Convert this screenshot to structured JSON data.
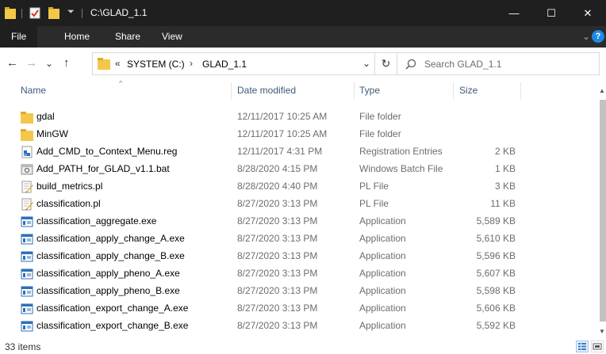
{
  "window": {
    "title": "C:\\GLAD_1.1"
  },
  "title_controls": {
    "minimize": "—",
    "maximize": "☐",
    "close": "✕"
  },
  "ribbon": {
    "tabs": [
      "File",
      "Home",
      "Share",
      "View"
    ],
    "expand": "⌄",
    "help": "?"
  },
  "nav": {
    "back": "←",
    "forward": "→",
    "recent": "⌄",
    "up": "↑",
    "overflow": "«",
    "breadcrumb": [
      "SYSTEM (C:)",
      "GLAD_1.1"
    ],
    "separator": "›",
    "dropdown": "⌄",
    "refresh": "↻",
    "search_placeholder": "Search GLAD_1.1"
  },
  "columns": {
    "name": "Name",
    "date": "Date modified",
    "type": "Type",
    "size": "Size",
    "sort_indicator": "^"
  },
  "files": [
    {
      "name": "gdal",
      "date": "12/11/2017 10:25 AM",
      "type": "File folder",
      "size": "",
      "icon": "folder-icon"
    },
    {
      "name": "MinGW",
      "date": "12/11/2017 10:25 AM",
      "type": "File folder",
      "size": "",
      "icon": "folder-icon"
    },
    {
      "name": "Add_CMD_to_Context_Menu.reg",
      "date": "12/11/2017 4:31 PM",
      "type": "Registration Entries",
      "size": "2 KB",
      "icon": "registry-file-icon"
    },
    {
      "name": "Add_PATH_for_GLAD_v1.1.bat",
      "date": "8/28/2020 4:15 PM",
      "type": "Windows Batch File",
      "size": "1 KB",
      "icon": "batch-file-icon"
    },
    {
      "name": "build_metrics.pl",
      "date": "8/28/2020 4:40 PM",
      "type": "PL File",
      "size": "3 KB",
      "icon": "script-file-icon"
    },
    {
      "name": "classification.pl",
      "date": "8/27/2020 3:13 PM",
      "type": "PL File",
      "size": "11 KB",
      "icon": "script-file-icon"
    },
    {
      "name": "classification_aggregate.exe",
      "date": "8/27/2020 3:13 PM",
      "type": "Application",
      "size": "5,589 KB",
      "icon": "application-icon"
    },
    {
      "name": "classification_apply_change_A.exe",
      "date": "8/27/2020 3:13 PM",
      "type": "Application",
      "size": "5,610 KB",
      "icon": "application-icon"
    },
    {
      "name": "classification_apply_change_B.exe",
      "date": "8/27/2020 3:13 PM",
      "type": "Application",
      "size": "5,596 KB",
      "icon": "application-icon"
    },
    {
      "name": "classification_apply_pheno_A.exe",
      "date": "8/27/2020 3:13 PM",
      "type": "Application",
      "size": "5,607 KB",
      "icon": "application-icon"
    },
    {
      "name": "classification_apply_pheno_B.exe",
      "date": "8/27/2020 3:13 PM",
      "type": "Application",
      "size": "5,598 KB",
      "icon": "application-icon"
    },
    {
      "name": "classification_export_change_A.exe",
      "date": "8/27/2020 3:13 PM",
      "type": "Application",
      "size": "5,606 KB",
      "icon": "application-icon"
    },
    {
      "name": "classification_export_change_B.exe",
      "date": "8/27/2020 3:13 PM",
      "type": "Application",
      "size": "5,592 KB",
      "icon": "application-icon"
    }
  ],
  "status": {
    "items": "33 items"
  },
  "colors": {
    "titlebar": "#1f1f1f",
    "ribbon": "#2b2b2b",
    "folder": "#f3c74a",
    "accent": "#1e88e5",
    "header_text": "#3c5a78"
  }
}
